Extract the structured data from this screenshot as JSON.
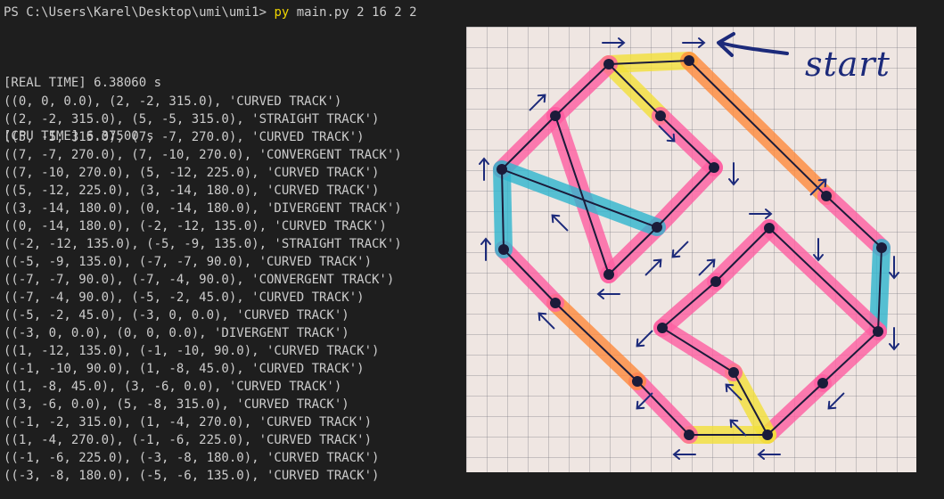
{
  "terminal": {
    "prompt": "PS C:\\Users\\Karel\\Desktop\\umi\\umi1> ",
    "command": "py",
    "args": " main.py 2 16 2 2",
    "real_time": "[REAL TIME] 6.38060 s",
    "cpu_time": "[CPU TIME] 6.37500 s",
    "lines": [
      "((0, 0, 0.0), (2, -2, 315.0), 'CURVED TRACK')",
      "((2, -2, 315.0), (5, -5, 315.0), 'STRAIGHT TRACK')",
      "((5, -5, 315.0), (7, -7, 270.0), 'CURVED TRACK')",
      "((7, -7, 270.0), (7, -10, 270.0), 'CONVERGENT TRACK')",
      "((7, -10, 270.0), (5, -12, 225.0), 'CURVED TRACK')",
      "((5, -12, 225.0), (3, -14, 180.0), 'CURVED TRACK')",
      "((3, -14, 180.0), (0, -14, 180.0), 'DIVERGENT TRACK')",
      "((0, -14, 180.0), (-2, -12, 135.0), 'CURVED TRACK')",
      "((-2, -12, 135.0), (-5, -9, 135.0), 'STRAIGHT TRACK')",
      "((-5, -9, 135.0), (-7, -7, 90.0), 'CURVED TRACK')",
      "((-7, -7, 90.0), (-7, -4, 90.0), 'CONVERGENT TRACK')",
      "((-7, -4, 90.0), (-5, -2, 45.0), 'CURVED TRACK')",
      "((-5, -2, 45.0), (-3, 0, 0.0), 'CURVED TRACK')",
      "((-3, 0, 0.0), (0, 0, 0.0), 'DIVERGENT TRACK')",
      "((1, -12, 135.0), (-1, -10, 90.0), 'CURVED TRACK')",
      "((-1, -10, 90.0), (1, -8, 45.0), 'CURVED TRACK')",
      "((1, -8, 45.0), (3, -6, 0.0), 'CURVED TRACK')",
      "((3, -6, 0.0), (5, -8, 315.0), 'CURVED TRACK')",
      "((-1, -2, 315.0), (1, -4, 270.0), 'CURVED TRACK')",
      "((1, -4, 270.0), (-1, -6, 225.0), 'CURVED TRACK')",
      "((-1, -6, 225.0), (-3, -8, 180.0), 'CURVED TRACK')",
      "((-3, -8, 180.0), (-5, -6, 135.0), 'CURVED TRACK')"
    ]
  },
  "photo": {
    "handwritten_label": "start",
    "colors": {
      "curved": "#ff5fa2",
      "straight": "#ff8a3d",
      "convergent": "#2fb6cf",
      "divergent": "#f3e13a",
      "ink": "#1b1b3a",
      "arrow": "#1c2a7a"
    }
  }
}
